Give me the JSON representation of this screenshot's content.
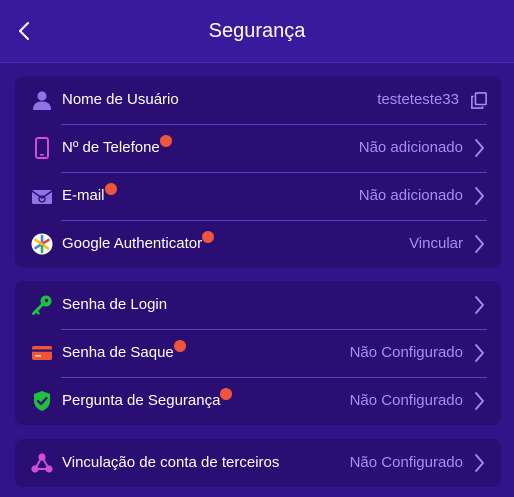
{
  "header": {
    "title": "Segurança"
  },
  "sections": [
    {
      "rows": [
        {
          "label": "Nome de Usuário",
          "value": "testeteste33",
          "icon": "user-icon",
          "badge": false,
          "action": "copy-icon"
        },
        {
          "label": "Nº de Telefone",
          "value": "Não adicionado",
          "icon": "phone-icon",
          "badge": true,
          "action": "chevron-right-icon"
        },
        {
          "label": "E-mail",
          "value": "Não adicionado",
          "icon": "email-icon",
          "badge": true,
          "action": "chevron-right-icon"
        },
        {
          "label": "Google Authenticator",
          "value": "Vincular",
          "icon": "google-authenticator-icon",
          "badge": true,
          "action": "chevron-right-icon"
        }
      ]
    },
    {
      "rows": [
        {
          "label": "Senha de Login",
          "value": "",
          "icon": "key-icon",
          "badge": false,
          "action": "chevron-right-icon"
        },
        {
          "label": "Senha de Saque",
          "value": "Não Configurado",
          "icon": "card-icon",
          "badge": true,
          "action": "chevron-right-icon"
        },
        {
          "label": "Pergunta de Segurança",
          "value": "Não Configurado",
          "icon": "shield-check-icon",
          "badge": true,
          "action": "chevron-right-icon"
        }
      ]
    },
    {
      "rows": [
        {
          "label": "Vinculação de conta de terceiros",
          "value": "Não Configurado",
          "icon": "link-nodes-icon",
          "badge": false,
          "action": "chevron-right-icon"
        }
      ]
    }
  ],
  "colors": {
    "background": "#32148a",
    "card": "#2a0e74",
    "value_text": "#a98ef0",
    "badge": "#f0553a",
    "divider": "#5a3fc2"
  }
}
